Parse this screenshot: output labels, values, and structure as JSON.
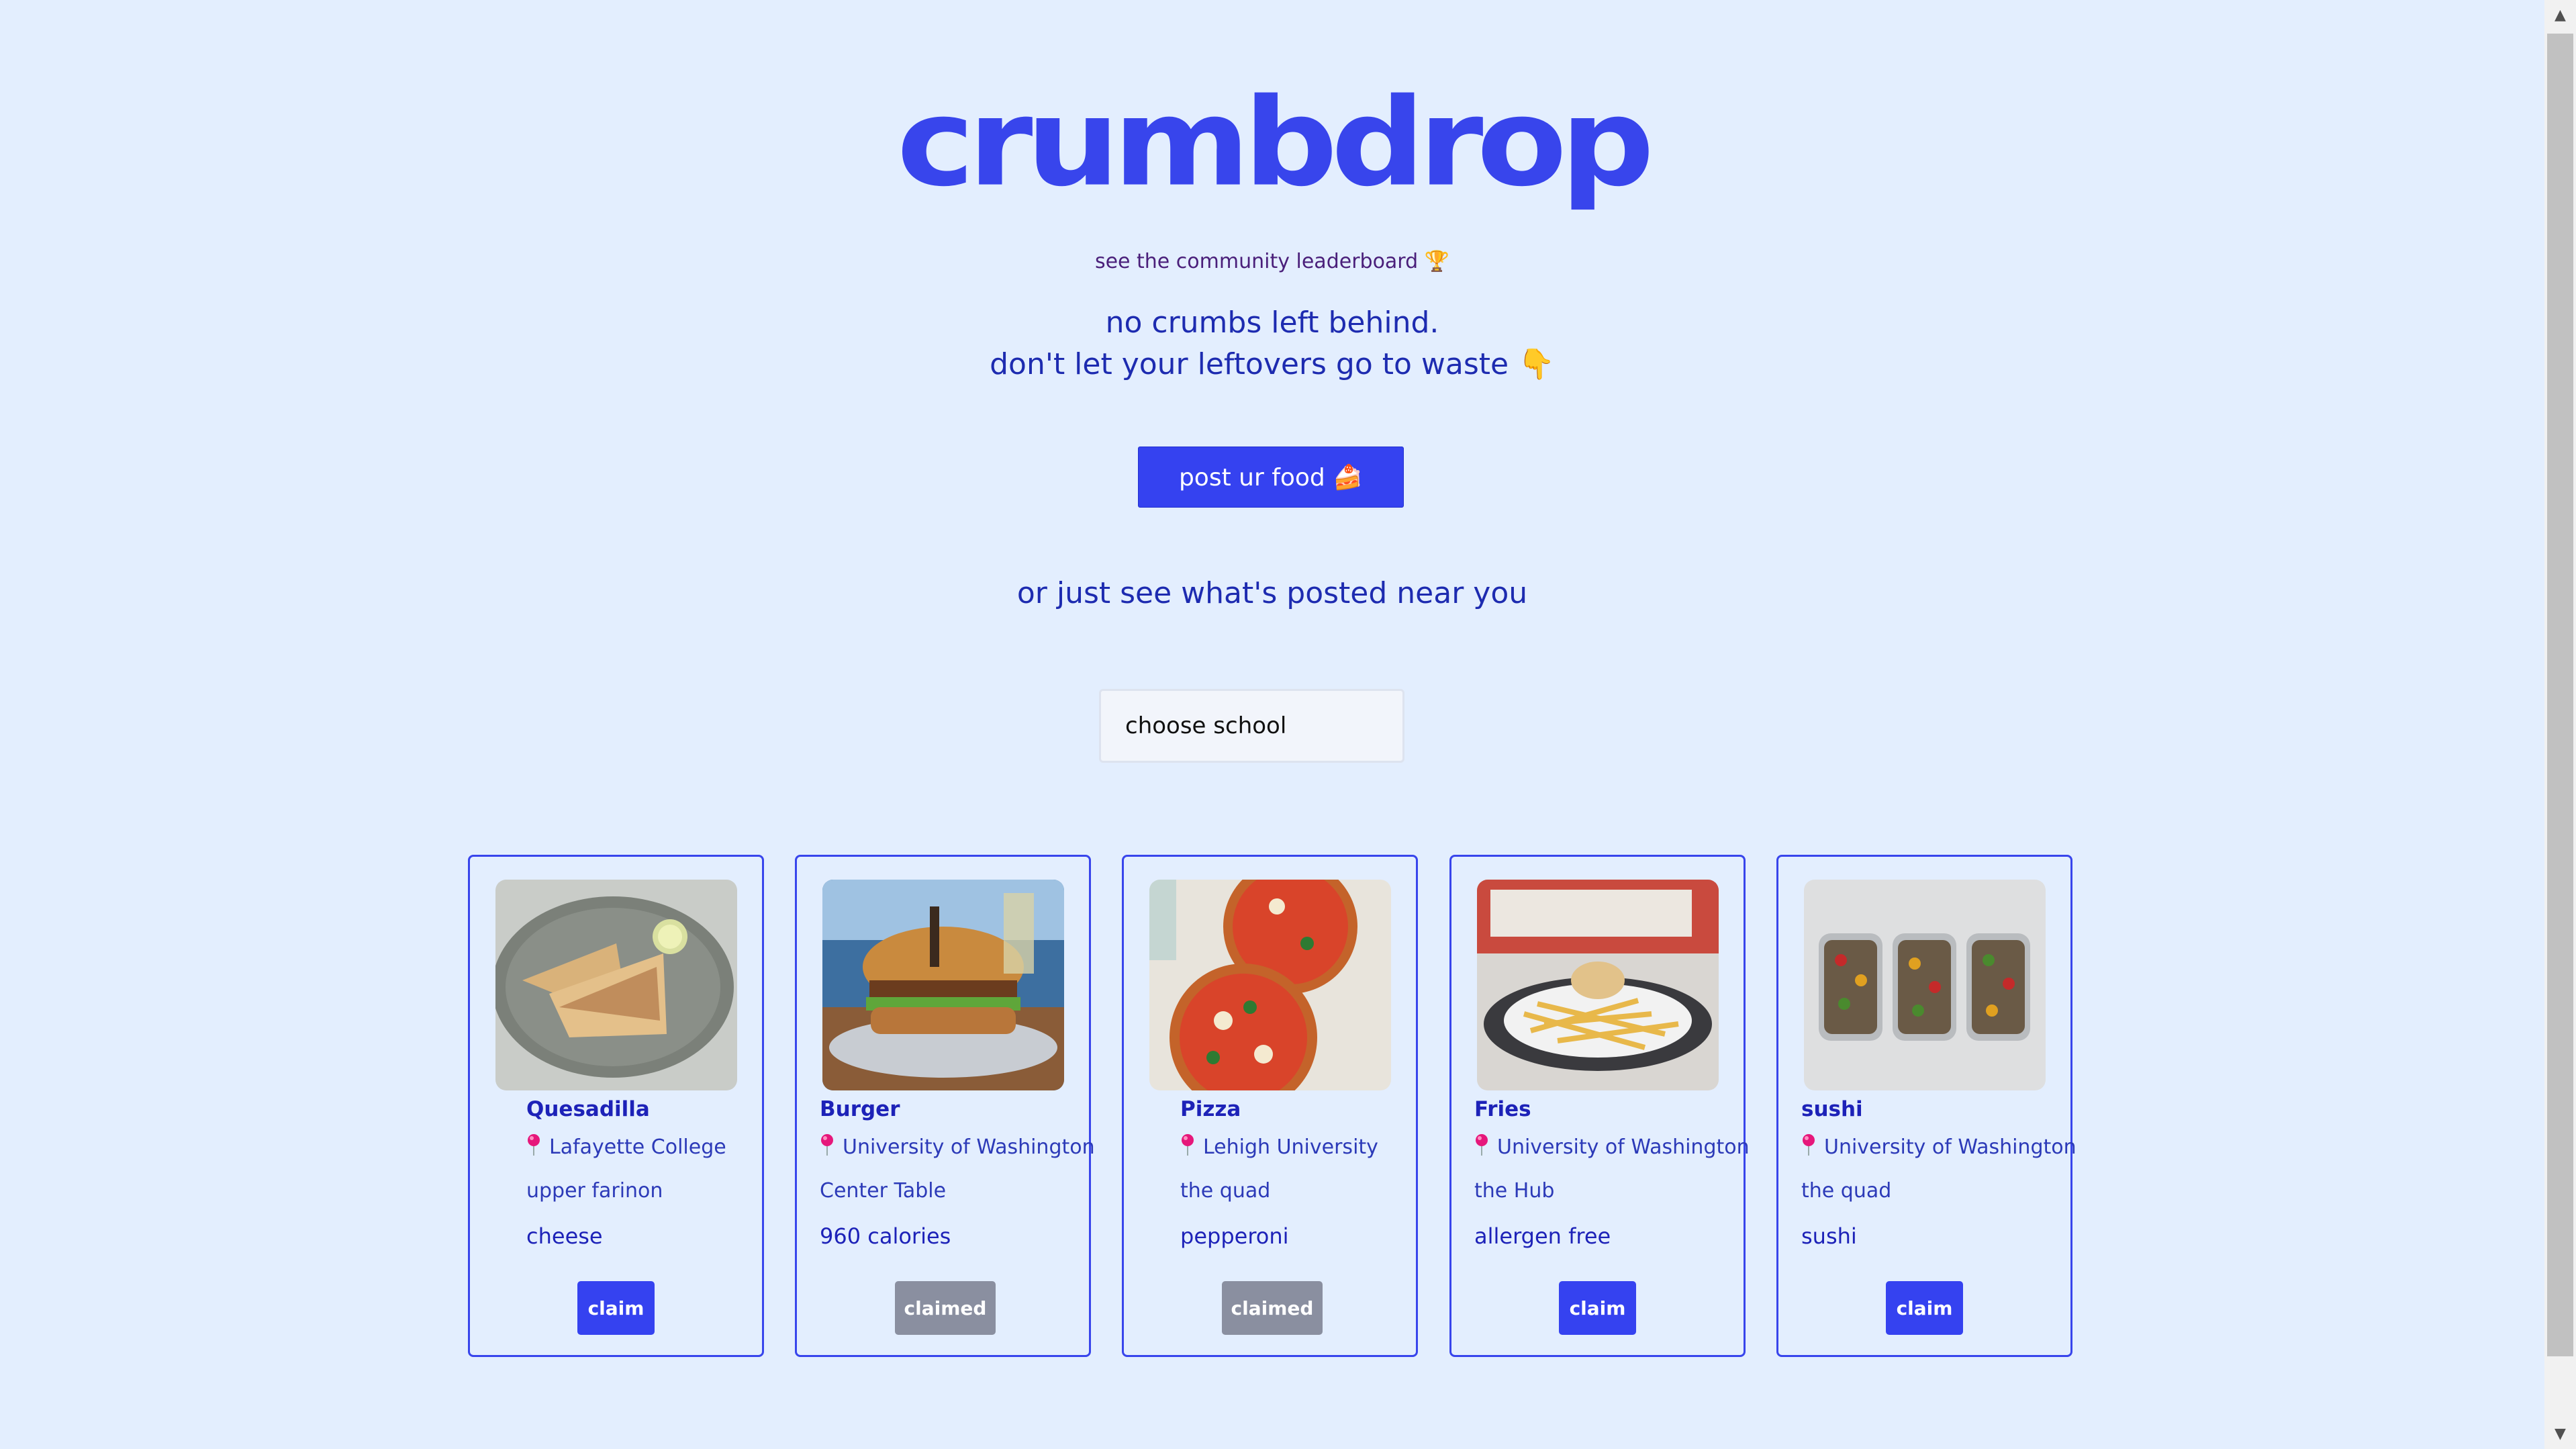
{
  "brand": {
    "logo_text": "crumbdrop",
    "accent_color": "#3845ec"
  },
  "header": {
    "leaderboard_link": "see the community leaderboard 🏆",
    "tagline_line1": "no crumbs left behind.",
    "tagline_line2": "don't let your leftovers go to waste 👇",
    "post_button_label": "post ur food 🍰",
    "near_text": "or just see what's posted near you"
  },
  "filter": {
    "school_select_value": "choose school"
  },
  "posts": [
    {
      "name": "Quesadilla",
      "school": "Lafayette College",
      "location": "upper farinon",
      "detail": "cheese",
      "button_label": "claim",
      "status": "available",
      "photo_icon": "quesadilla-photo"
    },
    {
      "name": "Burger",
      "school": "University of Washington",
      "location": "Center Table",
      "detail": "960 calories",
      "button_label": "claimed",
      "status": "claimed",
      "photo_icon": "burger-photo"
    },
    {
      "name": "Pizza",
      "school": "Lehigh University",
      "location": "the quad",
      "detail": "pepperoni",
      "button_label": "claimed",
      "status": "claimed",
      "photo_icon": "pizza-photo"
    },
    {
      "name": "Fries",
      "school": "University of Washington",
      "location": "the Hub",
      "detail": "allergen free",
      "button_label": "claim",
      "status": "available",
      "photo_icon": "fries-photo"
    },
    {
      "name": "sushi",
      "school": "University of Washington",
      "location": "the quad",
      "detail": "sushi",
      "button_label": "claim",
      "status": "available",
      "photo_icon": "sushi-photo"
    }
  ]
}
